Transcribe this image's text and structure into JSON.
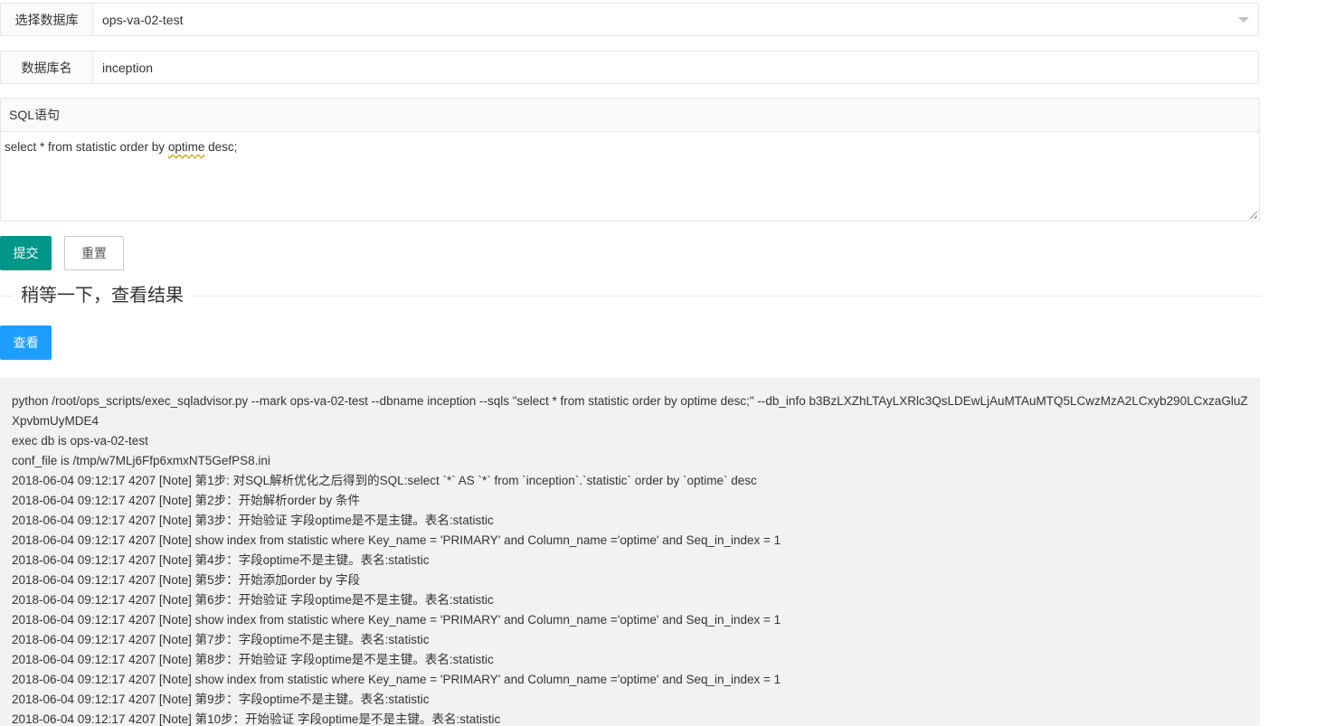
{
  "form": {
    "db_select": {
      "label": "选择数据库",
      "value": "ops-va-02-test"
    },
    "db_name": {
      "label": "数据库名",
      "value": "inception"
    },
    "sql": {
      "label": "SQL语句",
      "value_before": "select * from statistic order by ",
      "value_spell": "optime",
      "value_after": " desc;"
    }
  },
  "buttons": {
    "submit": "提交",
    "reset": "重置",
    "view": "查看"
  },
  "divider_title": "稍等一下，查看结果",
  "output_lines": [
    "python /root/ops_scripts/exec_sqladvisor.py --mark ops-va-02-test --dbname inception --sqls \"select * from statistic order by optime desc;\" --db_info b3BzLXZhLTAyLXRlc3QsLDEwLjAuMTAuMTQ5LCwzMzA2LCxyb290LCxzaGluZXpvbmUyMDE4",
    "exec db is ops-va-02-test",
    "conf_file is /tmp/w7MLj6Ffp6xmxNT5GefPS8.ini",
    "2018-06-04 09:12:17 4207 [Note] 第1步: 对SQL解析优化之后得到的SQL:select `*` AS `*` from `inception`.`statistic` order by `optime` desc",
    "2018-06-04 09:12:17 4207 [Note] 第2步：开始解析order by 条件",
    "2018-06-04 09:12:17 4207 [Note] 第3步：开始验证 字段optime是不是主键。表名:statistic",
    "2018-06-04 09:12:17 4207 [Note] show index from statistic where Key_name = 'PRIMARY' and Column_name ='optime' and Seq_in_index = 1",
    "2018-06-04 09:12:17 4207 [Note] 第4步：字段optime不是主键。表名:statistic",
    "2018-06-04 09:12:17 4207 [Note] 第5步：开始添加order by 字段",
    "2018-06-04 09:12:17 4207 [Note] 第6步：开始验证 字段optime是不是主键。表名:statistic",
    "2018-06-04 09:12:17 4207 [Note] show index from statistic where Key_name = 'PRIMARY' and Column_name ='optime' and Seq_in_index = 1",
    "2018-06-04 09:12:17 4207 [Note] 第7步：字段optime不是主键。表名:statistic",
    "2018-06-04 09:12:17 4207 [Note] 第8步：开始验证 字段optime是不是主键。表名:statistic",
    "2018-06-04 09:12:17 4207 [Note] show index from statistic where Key_name = 'PRIMARY' and Column_name ='optime' and Seq_in_index = 1",
    "2018-06-04 09:12:17 4207 [Note] 第9步：字段optime不是主键。表名:statistic",
    "2018-06-04 09:12:17 4207 [Note] 第10步：开始验证 字段optime是不是主键。表名:statistic"
  ],
  "colors": {
    "submit_bg": "#009688",
    "view_bg": "#1e9fff",
    "output_bg": "#f2f2f2"
  }
}
